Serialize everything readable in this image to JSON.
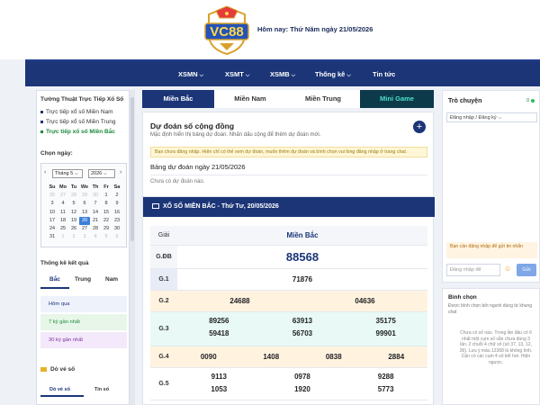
{
  "header": {
    "today_text": "Hôm nay: Thứ Năm ngày 21/05/2026"
  },
  "nav": [
    "XSMN",
    "XSMT",
    "XSMB",
    "Thống kê",
    "Tin tức"
  ],
  "left": {
    "live_title": "Tường Thuật Trực Tiếp Xổ Số",
    "live_links": [
      "Trực tiếp xổ số Miền Nam",
      "Trực tiếp xổ số Miền Trung",
      "Trực tiếp xổ số Miền Bắc"
    ],
    "choose_date_label": "Chọn ngày:",
    "calendar": {
      "month_label": "Tháng 5",
      "year_label": "2026",
      "weekdays": [
        "Su",
        "Mo",
        "Tu",
        "We",
        "Th",
        "Fr",
        "Sa"
      ],
      "weeks": [
        [
          "26",
          "27",
          "28",
          "29",
          "30",
          "1",
          "2"
        ],
        [
          "3",
          "4",
          "5",
          "6",
          "7",
          "8",
          "9"
        ],
        [
          "10",
          "11",
          "12",
          "13",
          "14",
          "15",
          "16"
        ],
        [
          "17",
          "18",
          "19",
          "20",
          "21",
          "22",
          "23"
        ],
        [
          "24",
          "25",
          "26",
          "27",
          "28",
          "29",
          "30"
        ],
        [
          "31",
          "1",
          "2",
          "3",
          "4",
          "5",
          "6"
        ]
      ]
    },
    "stats_title": "Thống kê kết quả",
    "stats_tabs": [
      "Bắc",
      "Trung",
      "Nam"
    ],
    "stats_items": [
      "Hôm qua",
      "7 kỳ gần nhất",
      "30 kỳ gần nhất"
    ],
    "ticket_title": "Dò vé số",
    "ticket_tabs": [
      "Dò vé số",
      "Tin số"
    ]
  },
  "main": {
    "region_tabs": [
      "Miền Bắc",
      "Miền Nam",
      "Miền Trung",
      "Mini Game"
    ],
    "prediction": {
      "title": "Dự đoán số cộng đồng",
      "subtitle": "Mặc định hiển thị bảng dự đoán. Nhấn dấu cộng để thêm dự đoán mới.",
      "notice": "Bạn chưa đăng nhập. Hiện chỉ có thể xem dự đoán, muốn thêm dự đoán và bình chọn vui lòng đăng nhập ở trang chat.",
      "plus": "+",
      "date_title": "Bảng dự đoán ngày 21/05/2026",
      "empty": "Chưa có dự đoán nào."
    },
    "results": {
      "title": "XỔ SỐ MIỀN BẮC - Thứ Tư, 20/05/2026",
      "col_label": "Giải",
      "col_region": "Miền Bắc",
      "rows": [
        {
          "label": "G.ĐB",
          "values": [
            "88568"
          ]
        },
        {
          "label": "G.1",
          "values": [
            "71876"
          ]
        },
        {
          "label": "G.2",
          "values": [
            "24688",
            "04636"
          ]
        },
        {
          "label": "G.3",
          "values": [
            "89256",
            "63913",
            "35175",
            "59418",
            "56703",
            "99901"
          ]
        },
        {
          "label": "G.4",
          "values": [
            "0090",
            "1408",
            "0838",
            "2884"
          ]
        },
        {
          "label": "G.5",
          "values": [
            "9113",
            "0978",
            "9288",
            "1053",
            "1920",
            "5773"
          ]
        }
      ]
    }
  },
  "right": {
    "chat_title": "Trò chuyện",
    "online_count": "0",
    "login_link": "Đăng nhập / Đăng ký",
    "login_warning": "Bạn cần đăng nhập để gửi tin nhắn",
    "input_placeholder": "Đăng nhập để",
    "emoji": "☺",
    "send_label": "Gửi",
    "vote_title": "Bình chọn",
    "vote_subtitle": "Được bình chọn bởi người dùng từ khung chat",
    "vote_empty": "Chưa có số nào. Trong lần đầu có 6 nhất một cụm số vẫn chưa đúng 3 lần. 2 chuỗi 4 chữ số (số 37, 13, 12, 36). Lưu ý màu 12368 là không tính. Cần có các cụm 4 số kết hơi. Hiện ngược."
  },
  "colors": {
    "nav_bg": "#1b3577",
    "accent_green": "#1a8a3a",
    "minigame": "#4ce0c9"
  }
}
